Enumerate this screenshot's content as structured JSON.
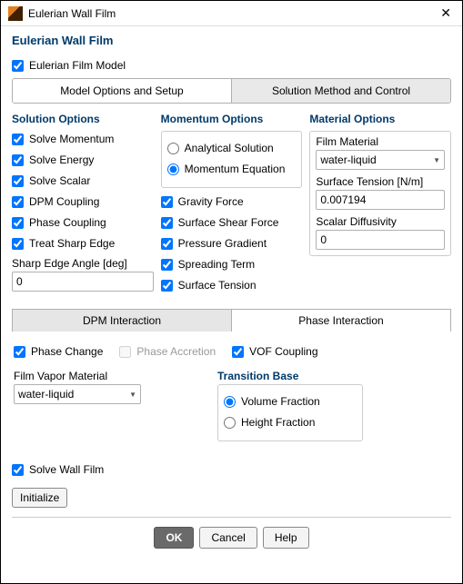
{
  "window": {
    "title": "Eulerian Wall Film"
  },
  "page_title": "Eulerian Wall Film",
  "eulerian_film_model": {
    "label": "Eulerian Film Model",
    "checked": true
  },
  "tabs": {
    "model": "Model Options and Setup",
    "solution": "Solution Method and Control",
    "active": "model"
  },
  "solution_options": {
    "title": "Solution Options",
    "solve_momentum": {
      "label": "Solve Momentum",
      "checked": true
    },
    "solve_energy": {
      "label": "Solve Energy",
      "checked": true
    },
    "solve_scalar": {
      "label": "Solve Scalar",
      "checked": true
    },
    "dpm_coupling": {
      "label": "DPM Coupling",
      "checked": true
    },
    "phase_coupling": {
      "label": "Phase Coupling",
      "checked": true
    },
    "treat_sharp_edge": {
      "label": "Treat Sharp Edge",
      "checked": true
    },
    "sharp_edge_angle": {
      "label": "Sharp Edge Angle [deg]",
      "value": "0"
    }
  },
  "momentum_options": {
    "title": "Momentum Options",
    "method": {
      "analytical": {
        "label": "Analytical Solution",
        "selected": false
      },
      "momentum_eq": {
        "label": "Momentum Equation",
        "selected": true
      }
    },
    "gravity_force": {
      "label": "Gravity Force",
      "checked": true
    },
    "surface_shear_force": {
      "label": "Surface Shear Force",
      "checked": true
    },
    "pressure_gradient": {
      "label": "Pressure Gradient",
      "checked": true
    },
    "spreading_term": {
      "label": "Spreading Term",
      "checked": true
    },
    "surface_tension": {
      "label": "Surface Tension",
      "checked": true
    }
  },
  "material_options": {
    "title": "Material Options",
    "film_material": {
      "label": "Film Material",
      "value": "water-liquid"
    },
    "surface_tension": {
      "label": "Surface Tension [N/m]",
      "value": "0.007194"
    },
    "scalar_diffusivity": {
      "label": "Scalar Diffusivity",
      "value": "0"
    }
  },
  "sub_tabs": {
    "dpm": "DPM Interaction",
    "phase": "Phase Interaction",
    "active": "phase"
  },
  "phase_interaction": {
    "phase_change": {
      "label": "Phase Change",
      "checked": true
    },
    "phase_accretion": {
      "label": "Phase Accretion",
      "checked": false,
      "enabled": false
    },
    "vof_coupling": {
      "label": "VOF Coupling",
      "checked": true
    },
    "film_vapor_material": {
      "label": "Film Vapor Material",
      "value": "water-liquid"
    },
    "transition_base": {
      "title": "Transition Base",
      "volume_fraction": {
        "label": "Volume Fraction",
        "selected": true
      },
      "height_fraction": {
        "label": "Height Fraction",
        "selected": false
      }
    }
  },
  "solve_wall_film": {
    "label": "Solve Wall Film",
    "checked": true
  },
  "initialize_label": "Initialize",
  "buttons": {
    "ok": "OK",
    "cancel": "Cancel",
    "help": "Help"
  }
}
